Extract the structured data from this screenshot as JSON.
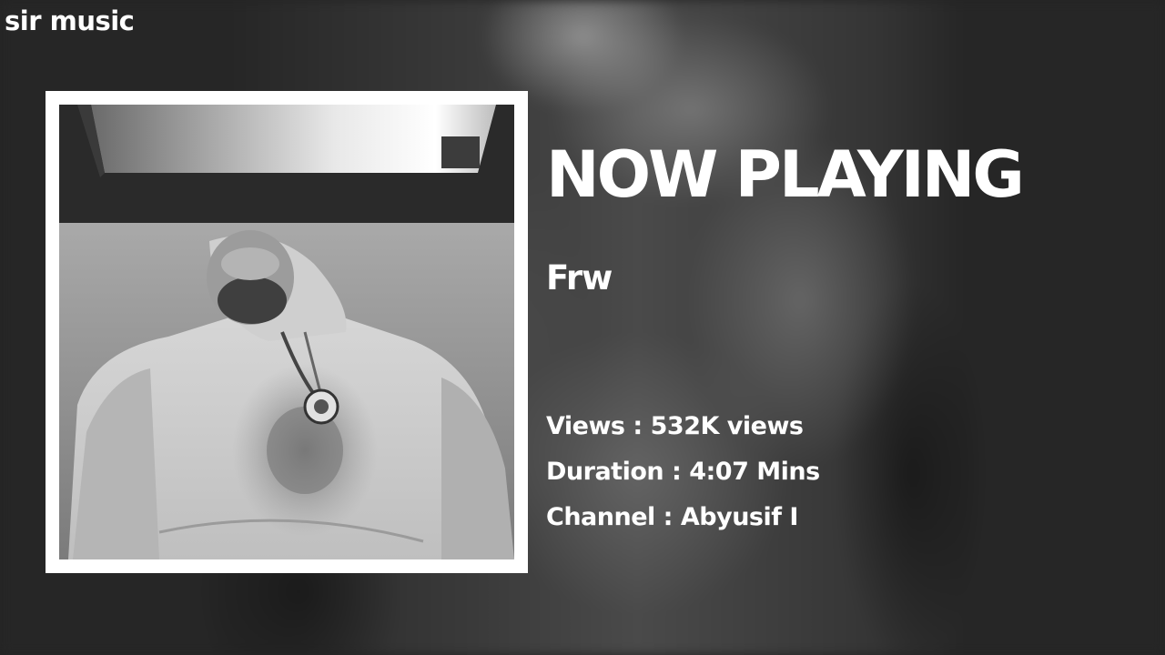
{
  "brand": "sir music",
  "header": "NOW PLAYING",
  "track": {
    "title": "Frw"
  },
  "details": [
    {
      "label": "Views",
      "sep": " : ",
      "value": "532K views"
    },
    {
      "label": "Duration",
      "sep": " : ",
      "value": "4:07 Mins"
    },
    {
      "label": "Channel",
      "sep": " : ",
      "value": "Abyusif I"
    }
  ],
  "colors": {
    "text": "#ffffff",
    "frame": "#ffffff",
    "background": "#242424"
  }
}
